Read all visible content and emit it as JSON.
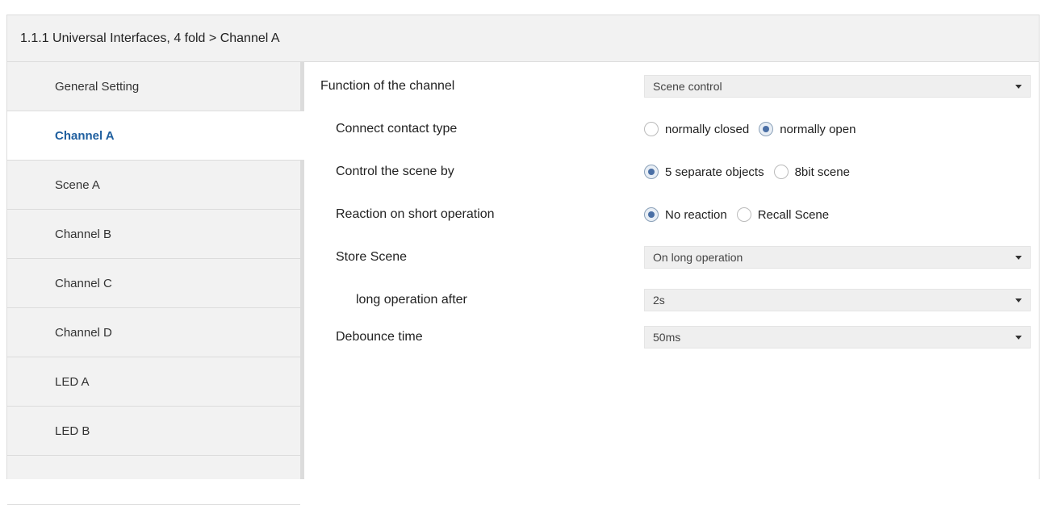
{
  "header": {
    "title": "1.1.1 Universal Interfaces, 4 fold > Channel A"
  },
  "sidebar": {
    "items": [
      {
        "label": "General Setting"
      },
      {
        "label": "Channel A",
        "active": true
      },
      {
        "label": "Scene A"
      },
      {
        "label": "Channel B"
      },
      {
        "label": "Channel C"
      },
      {
        "label": "Channel D"
      },
      {
        "label": "LED A"
      },
      {
        "label": "LED B"
      },
      {
        "label": ""
      }
    ]
  },
  "params": {
    "function": {
      "label": "Function of the channel",
      "value": "Scene control"
    },
    "contact": {
      "label": "Connect contact type",
      "options": [
        "normally closed",
        "normally open"
      ],
      "selected": "normally open"
    },
    "scene_by": {
      "label": "Control the scene by",
      "options": [
        "5 separate objects",
        "8bit scene"
      ],
      "selected": "5 separate objects"
    },
    "short_op": {
      "label": "Reaction on short operation",
      "options": [
        "No reaction",
        "Recall Scene"
      ],
      "selected": "No reaction"
    },
    "store": {
      "label": "Store Scene",
      "value": "On long operation"
    },
    "long_after": {
      "label": "long operation after",
      "value": "2s"
    },
    "debounce": {
      "label": "Debounce time",
      "value": "50ms"
    }
  },
  "colors": {
    "active_text": "#1f5f9f",
    "sidebar_bg": "#f2f2f2",
    "select_bg": "#efefef"
  }
}
